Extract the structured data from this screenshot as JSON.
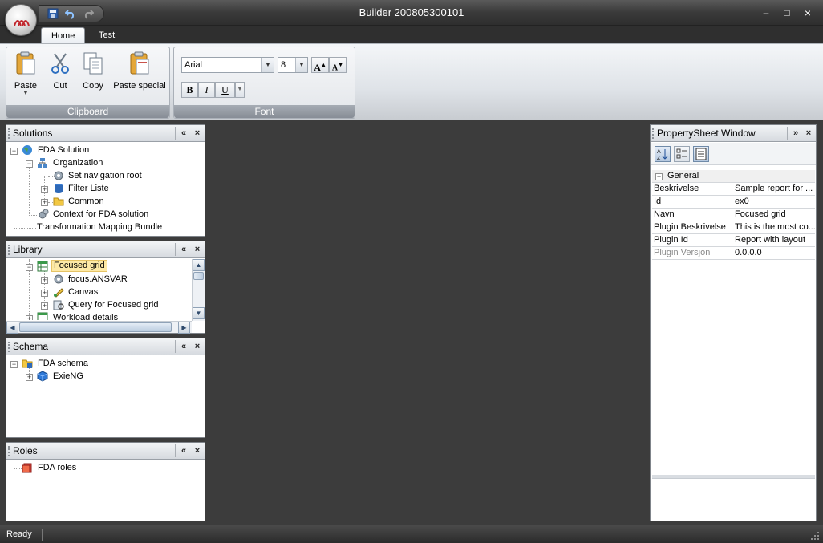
{
  "window": {
    "title": "Builder 200805300101",
    "minimize": "–",
    "maximize": "□",
    "close": "×"
  },
  "ribbon": {
    "tabs": [
      {
        "label": "Home"
      },
      {
        "label": "Test"
      }
    ],
    "clipboard": {
      "group_label": "Clipboard",
      "paste": "Paste",
      "cut": "Cut",
      "copy": "Copy",
      "paste_special": "Paste special"
    },
    "font": {
      "group_label": "Font",
      "family": "Arial",
      "size": "8",
      "bold": "B",
      "italic": "I",
      "underline": "U",
      "grow": "A",
      "shrink": "A"
    }
  },
  "panels": {
    "solutions": {
      "title": "Solutions",
      "nodes": [
        "FDA Solution",
        "Organization",
        "Set navigation root",
        "Filter Liste",
        "Common",
        "Context for FDA solution",
        "Transformation Mapping Bundle"
      ]
    },
    "library": {
      "title": "Library",
      "nodes": [
        "Focused grid",
        "focus.ANSVAR",
        "Canvas",
        "Query for Focused grid",
        "Workload details"
      ]
    },
    "schema": {
      "title": "Schema",
      "nodes": [
        "FDA schema",
        "ExieNG"
      ]
    },
    "roles": {
      "title": "Roles",
      "nodes": [
        "FDA roles"
      ]
    },
    "property_sheet": {
      "title": "PropertySheet Window",
      "category": "General",
      "rows": [
        {
          "key": "Beskrivelse",
          "value": "Sample report for ..."
        },
        {
          "key": "Id",
          "value": "ex0"
        },
        {
          "key": "Navn",
          "value": "Focused grid"
        },
        {
          "key": "Plugin Beskrivelse",
          "value": "This is the most co..."
        },
        {
          "key": "Plugin Id",
          "value": "Report with layout"
        },
        {
          "key": "Plugin Versjon",
          "value": "0.0.0.0"
        }
      ]
    }
  },
  "panel_buttons": {
    "collapse_left": "«",
    "collapse_right": "»",
    "close": "×"
  },
  "status": {
    "text": "Ready"
  },
  "icons": [
    "app-orb-icon",
    "save-icon",
    "undo-icon",
    "redo-icon",
    "paste-icon",
    "cut-icon",
    "copy-icon",
    "paste-special-icon",
    "grow-font-icon",
    "shrink-font-icon",
    "sort-alpha-icon",
    "categorized-icon",
    "property-pages-icon"
  ],
  "colors": {
    "window_chrome": "#3c3c3c",
    "ribbon_bg": "#dfe3e8",
    "selection": "#fde9a6",
    "group_label": "#878d96"
  }
}
